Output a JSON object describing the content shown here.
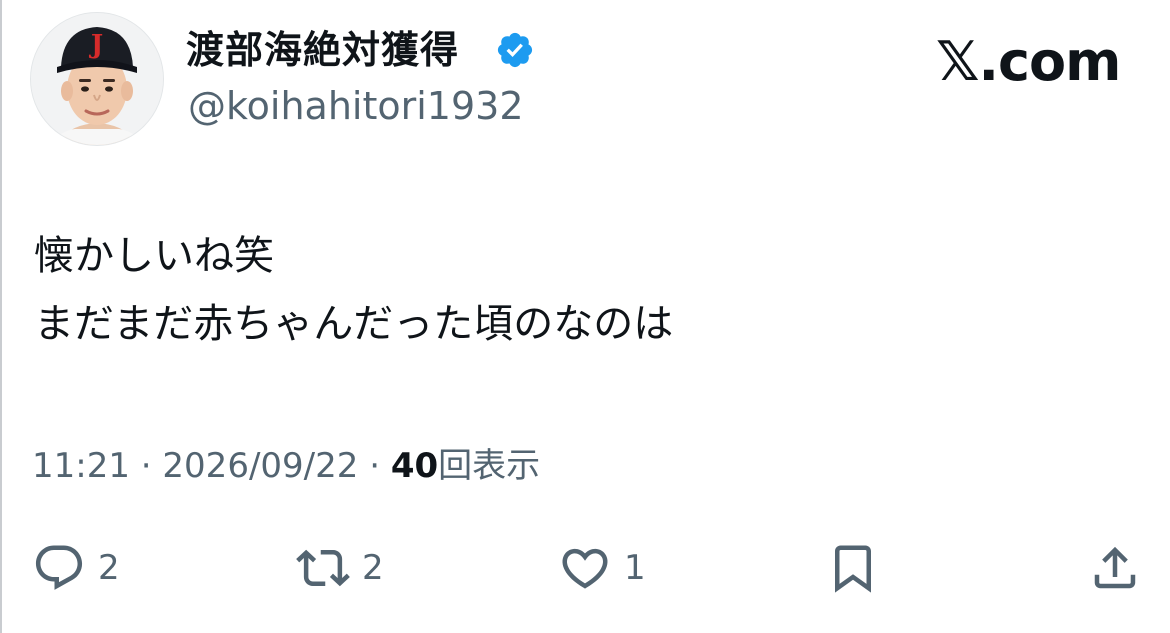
{
  "author": {
    "display_name": "渡部海絶対獲得",
    "handle": "@koihahitori1932",
    "verified": true,
    "verified_color": "#1d9bf0",
    "avatar": "avatar-photo"
  },
  "brand": {
    "label": "𝕏.com"
  },
  "tweet": {
    "lines": [
      "懐かしいね笑",
      "まだまだ赤ちゃんだった頃のなのは"
    ]
  },
  "meta": {
    "time": "11:21",
    "separator": "·",
    "date": "2026/09/22",
    "views_count": "40",
    "views_label": "回表示"
  },
  "actions": {
    "reply": {
      "icon": "reply-icon",
      "count": "2"
    },
    "repost": {
      "icon": "repost-icon",
      "count": "2"
    },
    "like": {
      "icon": "heart-icon",
      "count": "1"
    },
    "bookmark": {
      "icon": "bookmark-icon"
    },
    "share": {
      "icon": "share-icon"
    }
  },
  "colors": {
    "text": "#0f1419",
    "secondary": "#536471",
    "icon": "#536471"
  }
}
